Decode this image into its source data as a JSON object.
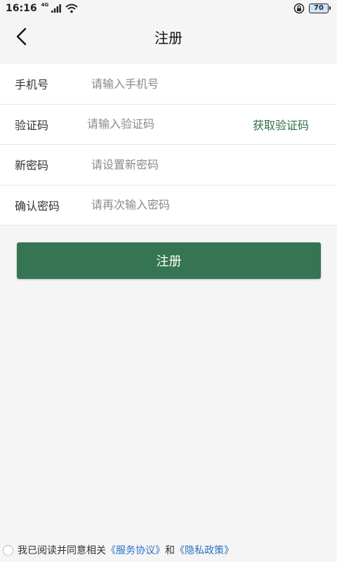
{
  "status_bar": {
    "time": "16:16",
    "network": "4G",
    "battery": "70"
  },
  "header": {
    "title": "注册"
  },
  "form": {
    "phone": {
      "label": "手机号",
      "placeholder": "请输入手机号"
    },
    "code": {
      "label": "验证码",
      "placeholder": "请输入验证码",
      "action": "获取验证码"
    },
    "new_password": {
      "label": "新密码",
      "placeholder": "请设置新密码"
    },
    "confirm_password": {
      "label": "确认密码",
      "placeholder": "请再次输入密码"
    }
  },
  "register_button": "注册",
  "agreement": {
    "prefix": "我已阅读并同意相关",
    "service_link": "《服务协议》",
    "conjunction": "和",
    "privacy_link": "《隐私政策》"
  },
  "colors": {
    "accent": "#367553",
    "link": "#2a72c9",
    "background": "#f5f5f5"
  }
}
